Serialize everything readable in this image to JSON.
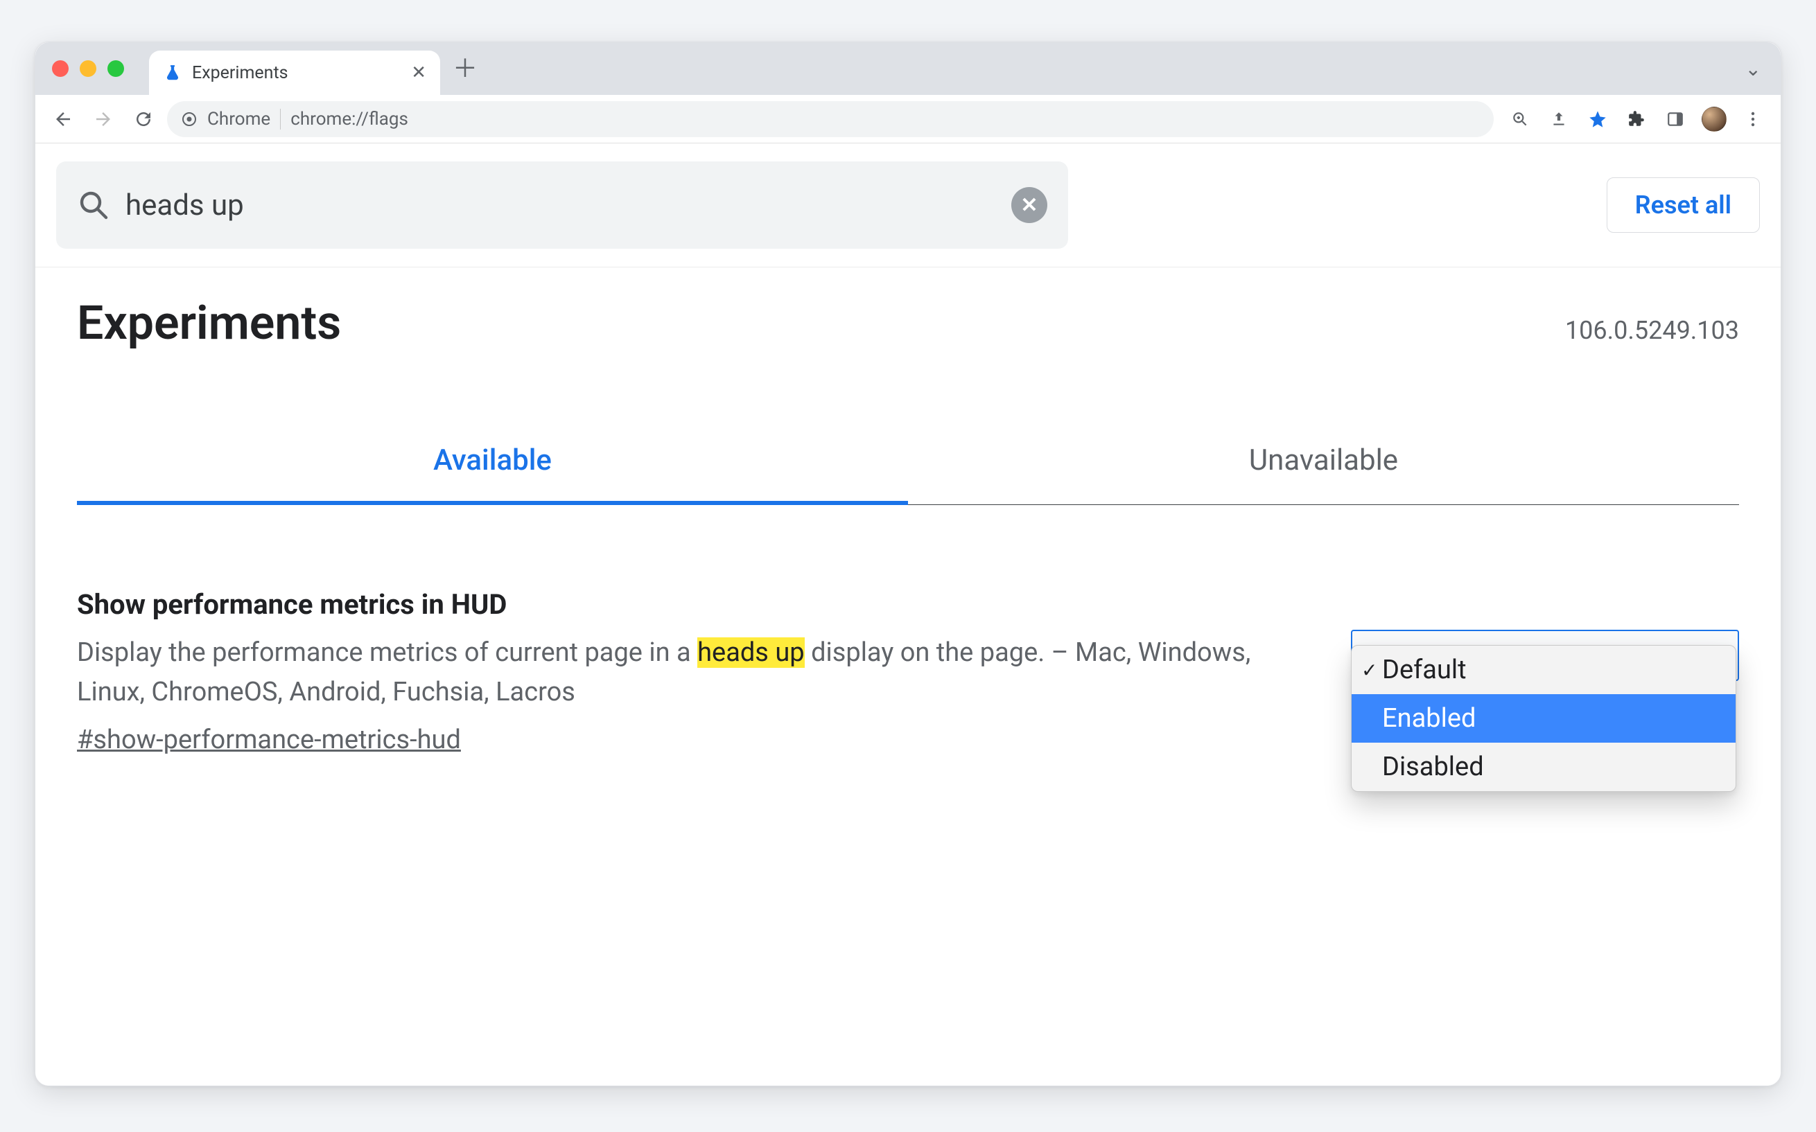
{
  "browser": {
    "tab_title": "Experiments",
    "omnibox_label": "Chrome",
    "omnibox_url": "chrome://flags"
  },
  "search": {
    "value": "heads up",
    "reset_label": "Reset all"
  },
  "header": {
    "title": "Experiments",
    "version": "106.0.5249.103"
  },
  "tabs": {
    "available": "Available",
    "unavailable": "Unavailable"
  },
  "flag": {
    "title": "Show performance metrics in HUD",
    "desc_before": "Display the performance metrics of current page in a ",
    "desc_highlight": "heads up",
    "desc_after": " display on the page. – Mac, Windows, Linux, ChromeOS, Android, Fuchsia, Lacros",
    "anchor": "#show-performance-metrics-hud",
    "options": {
      "default": "Default",
      "enabled": "Enabled",
      "disabled": "Disabled"
    }
  }
}
